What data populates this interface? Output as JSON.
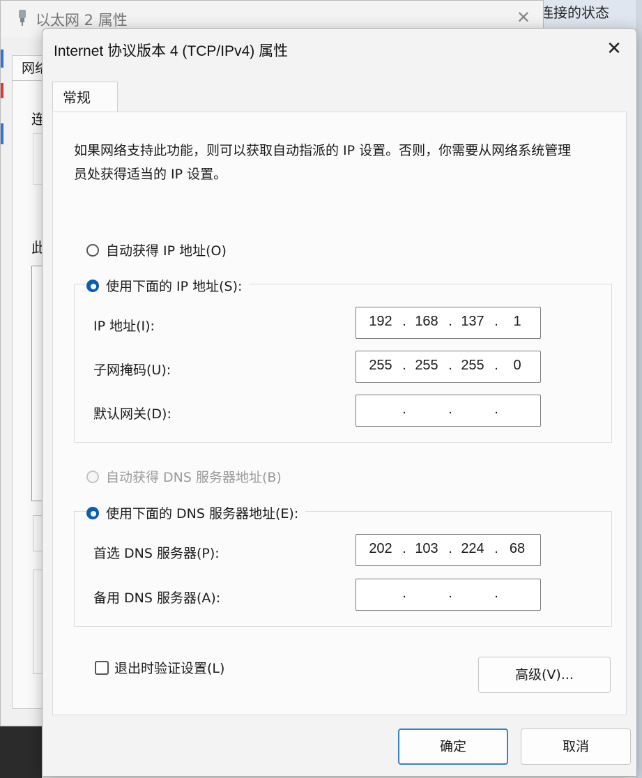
{
  "background": {
    "right_window_text": "连接的状态",
    "accent_colors": [
      "#3a6fd8",
      "#d83a3a"
    ]
  },
  "back_window": {
    "title": "以太网 2 属性",
    "title_icon": "network-adapter-icon",
    "close_icon": "close-icon",
    "tab_fragment": "网络",
    "fragment_connect": "连",
    "fragment_this": "此"
  },
  "dialog": {
    "title": "Internet 协议版本 4 (TCP/IPv4) 属性",
    "close_symbol": "✕",
    "tab_general": "常规",
    "description": "如果网络支持此功能，则可以获取自动指派的 IP 设置。否则，你需要从网络系统管理员处获得适当的 IP 设置。",
    "ip_section": {
      "auto_label": "自动获得 IP 地址(O)",
      "manual_label": "使用下面的 IP 地址(S):",
      "selected": "manual",
      "fields": {
        "ip": {
          "label": "IP 地址(I):",
          "octets": [
            "192",
            "168",
            "137",
            "1"
          ]
        },
        "mask": {
          "label": "子网掩码(U):",
          "octets": [
            "255",
            "255",
            "255",
            "0"
          ]
        },
        "gateway": {
          "label": "默认网关(D):",
          "octets": [
            "",
            "",
            "",
            ""
          ]
        }
      }
    },
    "dns_section": {
      "auto_label": "自动获得 DNS 服务器地址(B)",
      "manual_label": "使用下面的 DNS 服务器地址(E):",
      "selected": "manual",
      "fields": {
        "preferred": {
          "label": "首选 DNS 服务器(P):",
          "octets": [
            "202",
            "103",
            "224",
            "68"
          ]
        },
        "alternate": {
          "label": "备用 DNS 服务器(A):",
          "octets": [
            "",
            "",
            "",
            ""
          ]
        }
      }
    },
    "validate_label": "退出时验证设置(L)",
    "validate_checked": false,
    "advanced_button": "高级(V)...",
    "ok_button": "确定",
    "cancel_button": "取消",
    "accent_color": "#0a5cb5"
  }
}
